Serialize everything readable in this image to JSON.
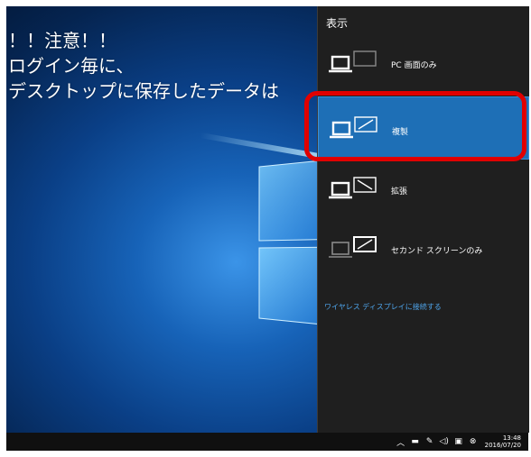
{
  "desktop": {
    "warning_lines": [
      "！！注意！！",
      "ログイン毎に、",
      "デスクトップに保存したデータは"
    ]
  },
  "project_panel": {
    "title": "表示",
    "options": [
      {
        "label": "PC 画面のみ",
        "icon": "pc-screen-only-icon",
        "selected": false
      },
      {
        "label": "複製",
        "icon": "duplicate-icon",
        "selected": true
      },
      {
        "label": "拡張",
        "icon": "extend-icon",
        "selected": false
      },
      {
        "label": "セカンド スクリーンのみ",
        "icon": "second-screen-only-icon",
        "selected": false
      }
    ],
    "wireless_link": "ワイヤレス ディスプレイに接続する"
  },
  "taskbar": {
    "tray_icons": [
      "chevron-up-icon",
      "network-icon",
      "pen-icon",
      "volume-icon",
      "notification-icon",
      "action-center-icon"
    ],
    "tray_glyphs": [
      "︿",
      "▬",
      "✎",
      "◁)",
      "▣",
      "⊗"
    ],
    "time": "13:48",
    "date": "2016/07/20"
  },
  "colors": {
    "panel_bg": "#1f1f1f",
    "selected_bg": "#1e6fb6",
    "accent_link": "#4fa7ef",
    "highlight_red": "#e10000"
  }
}
